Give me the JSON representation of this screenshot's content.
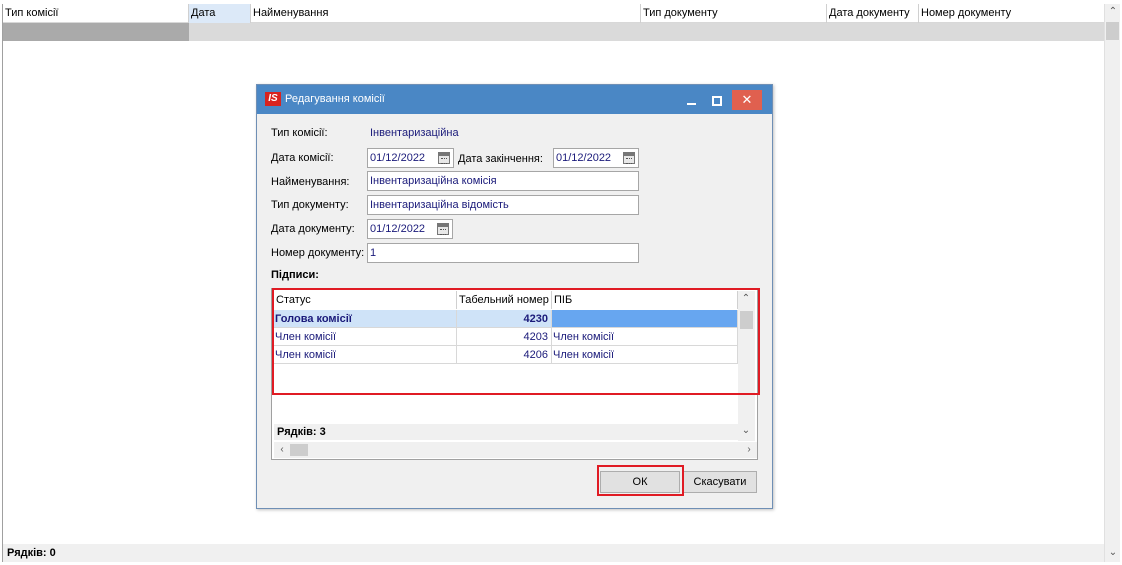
{
  "background": {
    "columns": [
      {
        "label": "Тип комісії",
        "width": 186
      },
      {
        "label": "Дата",
        "width": 62,
        "active": true
      },
      {
        "label": "Найменування",
        "width": 390
      },
      {
        "label": "Тип документу",
        "width": 186
      },
      {
        "label": "Дата документу",
        "width": 92
      },
      {
        "label": "Номер документу",
        "width": 186
      }
    ],
    "footer": "Рядків: 0"
  },
  "dialog": {
    "title": "Редагування комісії",
    "app_icon_text": "IS",
    "fields": {
      "type_label": "Тип комісії:",
      "type_value": "Інвентаризаційна",
      "date_label": "Дата комісії:",
      "date_value": "01/12/2022",
      "end_date_label": "Дата закінчення:",
      "end_date_value": "01/12/2022",
      "name_label": "Найменування:",
      "name_value": "Інвентаризаційна  комісія",
      "doc_type_label": "Тип документу:",
      "doc_type_value": "Інвентаризаційна відомість",
      "doc_date_label": "Дата документу:",
      "doc_date_value": "01/12/2022",
      "doc_number_label": "Номер документу:",
      "doc_number_value": "1"
    },
    "signatures": {
      "label": "Підписи:",
      "columns": [
        "Статус",
        "Табельний номер",
        "ПІБ"
      ],
      "rows": [
        {
          "status": "Голова комісії",
          "number": "4230",
          "name": ""
        },
        {
          "status": "Член комісії",
          "number": "4203",
          "name": "Член комісії"
        },
        {
          "status": "Член комісії",
          "number": "4206",
          "name": "Член комісії"
        }
      ],
      "footer": "Рядків: 3"
    },
    "buttons": {
      "ok": "ОК",
      "cancel": "Скасувати"
    }
  },
  "colors": {
    "titlebar": "#4a87c5",
    "close": "#e0604f",
    "highlight": "#e01b24",
    "value_text": "#1a1a7a",
    "selected_row": "#cfe3f8"
  }
}
